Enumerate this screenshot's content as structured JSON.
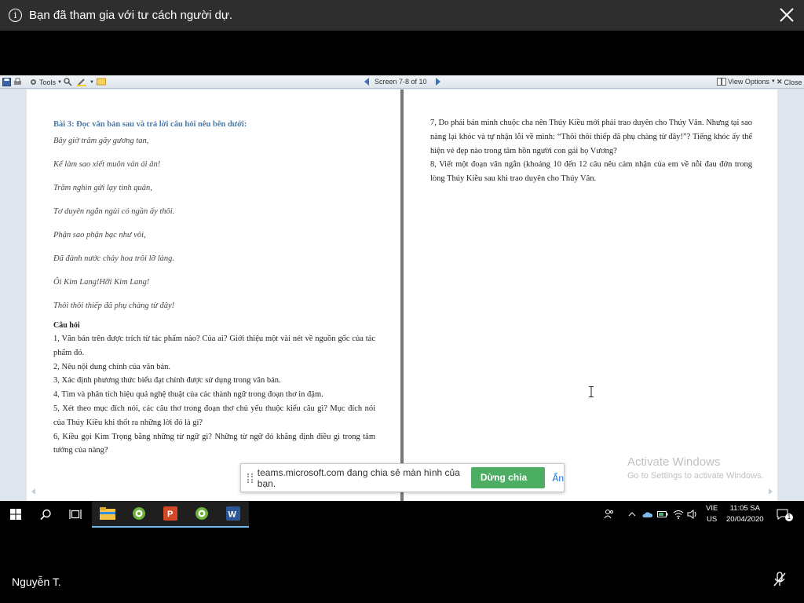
{
  "notification": {
    "text": "Bạn đã tham gia với tư cách người dự."
  },
  "toolbar": {
    "tools_label": "Tools",
    "screen_indicator": "Screen 7-8 of 10",
    "view_options_label": "View Options",
    "close_label": "Close"
  },
  "document": {
    "left": {
      "title": "Bài 3: Đọc văn bản sau và trả lời câu hỏi nêu bên dưới:",
      "poem": [
        "Bây giờ trâm gãy gương tan,",
        "Kể làm sao xiết muôn vàn ái ân!",
        "Trăm nghìn gửi lạy tình quân,",
        "Tơ duyên ngắn ngủi có ngần ấy thôi.",
        "Phận sao phận bạc như vôi,",
        "Đã đành nước chảy hoa trôi lỡ làng.",
        "Ôi Kim Lang!Hỡi Kim Lang!",
        "Thôi thôi thiếp đã phụ chàng từ đây!"
      ],
      "questions_heading": "Câu hỏi",
      "questions": [
        "1, Văn bản trên được trích từ tác phẩm nào? Của ai? Giới thiệu một vài nét về nguồn gốc của tác phẩm đó.",
        "2, Nêu nội dung chính của văn bản.",
        "3, Xác định phương thức biểu đạt chính được sử dụng trong văn bản.",
        "4, Tìm và phân tích hiệu quả nghệ thuật của các thành ngữ trong đoạn thơ in đậm.",
        "5, Xét theo mục đích nói, các câu thơ trong đoạn thơ chủ yếu thuộc kiểu câu gì? Mục đích nói của Thúy Kiều  khi thốt ra những lời đó là gì?",
        "6, Kiều gọi Kim Trọng bằng những từ ngữ gì? Những từ ngữ đó khẳng định điều gì trong tâm tưởng của nàng?"
      ]
    },
    "right": {
      "questions": [
        "7, Do phải bán mình chuộc cha nên Thúy Kiều mới phải trao duyên cho Thúy Vân. Nhưng tại sao nàng lại khóc và tự nhận lỗi về mình: “Thôi thôi thiếp đã phụ chàng từ đây!”? Tiếng khóc ấy thể hiện vẻ đẹp nào trong tâm hồn người con gái họ Vương?",
        "8, Viết một đoạn văn ngắn (khoảng 10 đến 12 câu nêu cảm nhận của em về nỗi đau đớn trong lòng Thúy Kiều sau khi trao duyên cho Thúy Vân."
      ]
    }
  },
  "share_bar": {
    "message": "teams.microsoft.com đang chia sẻ màn hình của bạn.",
    "stop_label": "Dừng chia sẻ",
    "hide_label": "Ẩn"
  },
  "watermark": {
    "title": "Activate Windows",
    "subtitle": "Go to Settings to activate Windows."
  },
  "taskbar": {
    "language_top": "VIE",
    "language_bottom": "US",
    "time": "11:05 SA",
    "date": "20/04/2020",
    "notification_count": "1",
    "apps": [
      "file-explorer",
      "coccoc-browser",
      "powerpoint",
      "coccoc-browser-2",
      "word"
    ]
  },
  "participant": {
    "name": "Nguyễn T."
  }
}
